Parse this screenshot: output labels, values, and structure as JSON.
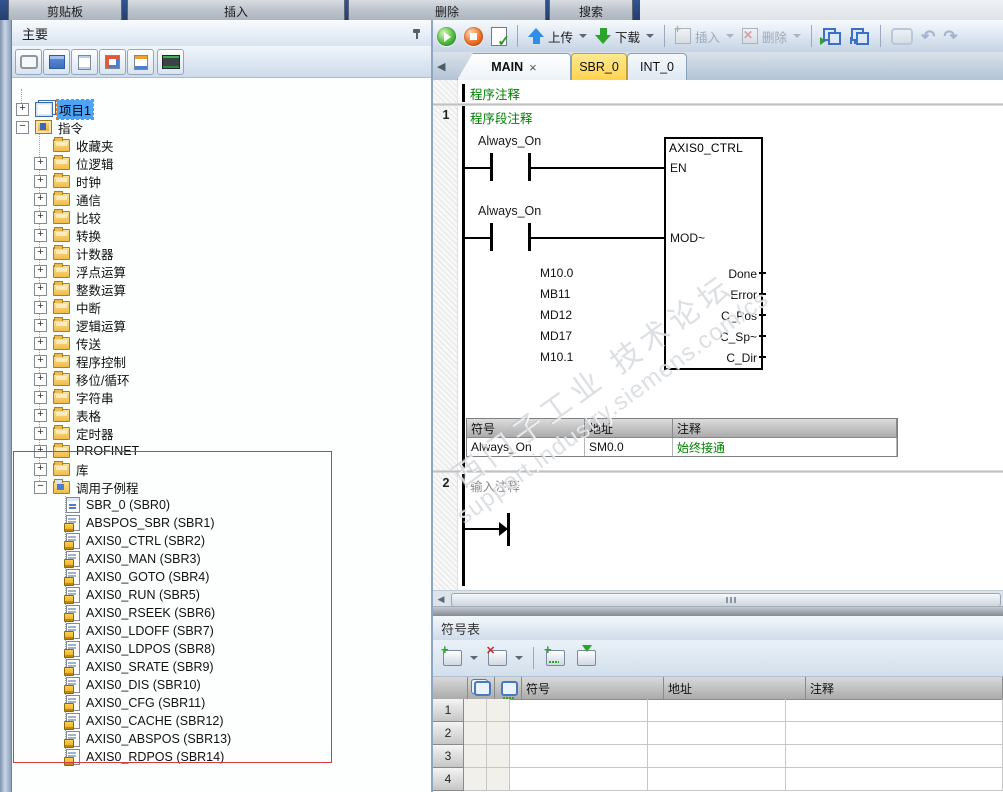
{
  "ribbon": {
    "groups": [
      "剪贴板",
      "插入",
      "删除",
      "搜索"
    ]
  },
  "nav": {
    "header": "主要",
    "tree": {
      "items": [
        {
          "exp": "+",
          "label": "项目1"
        },
        {
          "exp": "−",
          "label": "指令"
        },
        {
          "exp": "",
          "label": "收藏夹"
        },
        {
          "exp": "+",
          "label": "位逻辑"
        },
        {
          "exp": "+",
          "label": "时钟"
        },
        {
          "exp": "+",
          "label": "通信"
        },
        {
          "exp": "+",
          "label": "比较"
        },
        {
          "exp": "+",
          "label": "转换"
        },
        {
          "exp": "+",
          "label": "计数器"
        },
        {
          "exp": "+",
          "label": "浮点运算"
        },
        {
          "exp": "+",
          "label": "整数运算"
        },
        {
          "exp": "+",
          "label": "中断"
        },
        {
          "exp": "+",
          "label": "逻辑运算"
        },
        {
          "exp": "+",
          "label": "传送"
        },
        {
          "exp": "+",
          "label": "程序控制"
        },
        {
          "exp": "+",
          "label": "移位/循环"
        },
        {
          "exp": "+",
          "label": "字符串"
        },
        {
          "exp": "+",
          "label": "表格"
        },
        {
          "exp": "+",
          "label": "定时器"
        },
        {
          "exp": "+",
          "label": "PROFINET"
        },
        {
          "exp": "+",
          "label": "库"
        },
        {
          "exp": "−",
          "label": "调用子例程"
        },
        {
          "exp": "",
          "label": "SBR_0 (SBR0)"
        },
        {
          "exp": "",
          "label": "ABSPOS_SBR (SBR1)"
        },
        {
          "exp": "",
          "label": "AXIS0_CTRL (SBR2)"
        },
        {
          "exp": "",
          "label": "AXIS0_MAN (SBR3)"
        },
        {
          "exp": "",
          "label": "AXIS0_GOTO (SBR4)"
        },
        {
          "exp": "",
          "label": "AXIS0_RUN (SBR5)"
        },
        {
          "exp": "",
          "label": "AXIS0_RSEEK (SBR6)"
        },
        {
          "exp": "",
          "label": "AXIS0_LDOFF (SBR7)"
        },
        {
          "exp": "",
          "label": "AXIS0_LDPOS (SBR8)"
        },
        {
          "exp": "",
          "label": "AXIS0_SRATE (SBR9)"
        },
        {
          "exp": "",
          "label": "AXIS0_DIS (SBR10)"
        },
        {
          "exp": "",
          "label": "AXIS0_CFG (SBR11)"
        },
        {
          "exp": "",
          "label": "AXIS0_CACHE (SBR12)"
        },
        {
          "exp": "",
          "label": "AXIS0_ABSPOS (SBR13)"
        },
        {
          "exp": "",
          "label": "AXIS0_RDPOS (SBR14)"
        }
      ]
    }
  },
  "toolbar": {
    "upload": "上传",
    "download": "下载",
    "insert": "插入",
    "delete": "删除"
  },
  "tabs": {
    "items": [
      {
        "label": "MAIN"
      },
      {
        "label": "SBR_0"
      },
      {
        "label": "INT_0"
      }
    ]
  },
  "editor": {
    "program_comment": "程序注释",
    "network1": {
      "number": "1",
      "comment": "程序段注释",
      "contacts": [
        "Always_On",
        "Always_On"
      ],
      "block": {
        "title": "AXIS0_CTRL",
        "inputs": [
          "EN",
          "MOD~"
        ],
        "outputs": [
          {
            "pin": "Done",
            "addr": "M10.0"
          },
          {
            "pin": "Error",
            "addr": "MB11"
          },
          {
            "pin": "C_Pos",
            "addr": "MD12"
          },
          {
            "pin": "C_Sp~",
            "addr": "MD17"
          },
          {
            "pin": "C_Dir",
            "addr": "M10.1"
          }
        ]
      },
      "table": {
        "headers": [
          "符号",
          "地址",
          "注释"
        ],
        "row": {
          "symbol": "Always_On",
          "address": "SM0.0",
          "comment": "始终接通"
        }
      }
    },
    "network2": {
      "number": "2",
      "comment": "输入注释"
    }
  },
  "bottom_panel": {
    "title": "符号表",
    "columns": [
      "符号",
      "地址",
      "注释"
    ],
    "row_numbers": [
      "1",
      "2",
      "3",
      "4"
    ]
  },
  "watermark": {
    "line1": "西门子工业 技术论坛",
    "line2": "support.industry.siemens.com/cs"
  },
  "icons": {
    "close": "×",
    "back": "◀",
    "undo": "↶",
    "redo": "↷",
    "hscroll_left": "◀"
  }
}
